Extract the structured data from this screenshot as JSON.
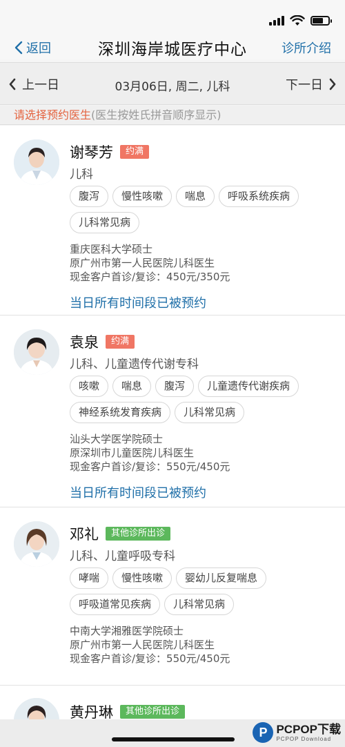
{
  "nav": {
    "back_label": "返回",
    "title": "深圳海岸城医疗中心",
    "right_label": "诊所介绍"
  },
  "date_bar": {
    "prev_label": "上一日",
    "current": "03月06日, 周二, 儿科",
    "next_label": "下一日"
  },
  "hint": {
    "primary": "请选择预约医生",
    "secondary": "(医生按姓氏拼音顺序显示)"
  },
  "doctors": [
    {
      "name": "谢琴芳",
      "badge": "约满",
      "dept": "儿科",
      "tags": [
        "腹泻",
        "慢性咳嗽",
        "喘息",
        "呼吸系统疾病",
        "儿科常见病"
      ],
      "info": [
        "重庆医科大学硕士",
        "原广州市第一人民医院儿科医生",
        "现金客户首诊/复诊：450元/350元"
      ],
      "booked": "当日所有时间段已被预约"
    },
    {
      "name": "袁泉",
      "badge": "约满",
      "dept": "儿科、儿童遗传代谢专科",
      "tags": [
        "咳嗽",
        "喘息",
        "腹泻",
        "儿童遗传代谢疾病",
        "神经系统发育疾病",
        "儿科常见病"
      ],
      "info": [
        "汕头大学医学院硕士",
        "原深圳市儿童医院儿科医生",
        "现金客户首诊/复诊：550元/450元"
      ],
      "booked": "当日所有时间段已被预约"
    },
    {
      "name": "邓礼",
      "badge": "其他诊所出诊",
      "dept": "儿科、儿童呼吸专科",
      "tags": [
        "哮喘",
        "慢性咳嗽",
        "婴幼儿反复喘息",
        "呼吸道常见疾病",
        "儿科常见病"
      ],
      "info": [
        "中南大学湘雅医学院硕士",
        "原广州市第一人民医院儿科医生",
        "现金客户首诊/复诊：550元/450元"
      ]
    },
    {
      "name": "黄丹琳",
      "badge": "其他诊所出诊"
    }
  ],
  "watermark": {
    "logo": "P",
    "main": "PCPOP下载",
    "sub": "PCPOP Download"
  }
}
